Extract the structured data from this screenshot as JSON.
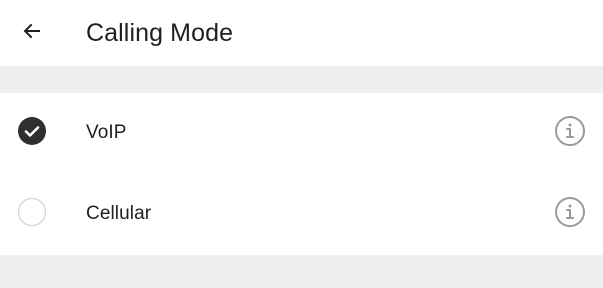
{
  "header": {
    "title": "Calling Mode",
    "back_icon": "arrow-left-icon"
  },
  "options": [
    {
      "label": "VoIP",
      "selected": true,
      "selection_icon": "check-circle-icon",
      "info_icon": "info-icon"
    },
    {
      "label": "Cellular",
      "selected": false,
      "selection_icon": "radio-empty-icon",
      "info_icon": "info-icon"
    }
  ],
  "colors": {
    "background": "#ffffff",
    "section_spacer": "#efeff1",
    "text_primary": "#1f1f1f",
    "selected_fill": "#2f2f2f",
    "unselected_stroke": "#d9d9d9",
    "info_icon": "#9a9a9a"
  }
}
